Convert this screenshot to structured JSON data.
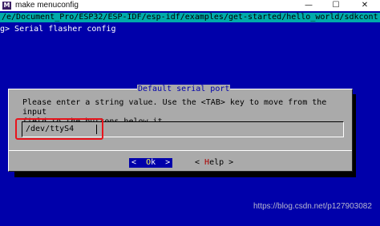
{
  "window": {
    "title": "make menuconfig",
    "app_icon_glyph": "M",
    "minimize_glyph": "—",
    "maximize_glyph": "☐",
    "close_glyph": "✕"
  },
  "terminal": {
    "path_line": "/e/Document_Pro/ESP32/ESP-IDF/esp-idf/examples/get-started/hello_world/sdkcont",
    "breadcrumb": "g> Serial flasher config",
    "background": "#0000aa",
    "path_bar_color": "#00aaaa"
  },
  "dialog": {
    "title": "Default serial port",
    "prompt_line1": "Please enter a string value. Use the <TAB> key to move from the input",
    "prompt_line2": "field to the buttons below it.",
    "input_value": "/dev/ttyS4",
    "buttons": {
      "ok_prefix": "<  ",
      "ok_hotkey": "O",
      "ok_rest": "k  >",
      "help_prefix": "< ",
      "help_hotkey": "H",
      "help_rest": "elp >"
    },
    "background": "#aaaaaa"
  },
  "annotation": {
    "highlight_color": "#e8141c"
  },
  "watermark": {
    "text": "https://blog.csdn.net/p127903082"
  }
}
